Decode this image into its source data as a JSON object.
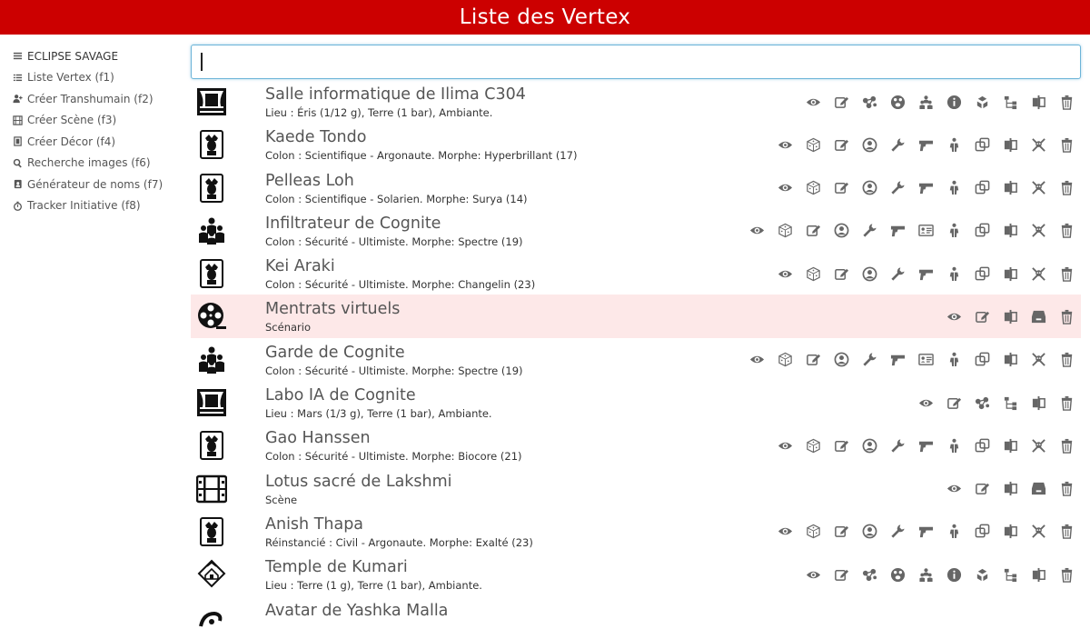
{
  "header": {
    "title": "Liste des Vertex"
  },
  "sidebar": {
    "items": [
      {
        "label": "ECLIPSE SAVAGE",
        "icon": "bars-icon"
      },
      {
        "label": "Liste Vertex (f1)",
        "icon": "list-icon"
      },
      {
        "label": "Créer Transhumain (f2)",
        "icon": "user-plus-icon"
      },
      {
        "label": "Créer Scène (f3)",
        "icon": "film-icon"
      },
      {
        "label": "Créer Décor (f4)",
        "icon": "door-icon"
      },
      {
        "label": "Recherche images (f6)",
        "icon": "search-icon"
      },
      {
        "label": "Générateur de noms (f7)",
        "icon": "address-book-icon"
      },
      {
        "label": "Tracker Initiative (f8)",
        "icon": "stopwatch-icon"
      }
    ]
  },
  "search": {
    "value": "",
    "placeholder": ""
  },
  "colors": {
    "header_bg": "#cc0000",
    "highlight_row": "#fde8e8",
    "icon_gray": "#666666",
    "search_border": "#6cb4d8"
  },
  "rows": [
    {
      "icon": "stage-icon",
      "title": "Salle informatique de Ilima C304",
      "subtitle": "Lieu : Éris (1/12 g), Terre (1 bar), Ambiante.",
      "actions": [
        "eye",
        "edit",
        "network",
        "paw",
        "group",
        "info",
        "cubes",
        "tree",
        "columns",
        "trash"
      ],
      "highlight": false
    },
    {
      "icon": "jester-icon",
      "title": "Kaede Tondo",
      "subtitle": "Colon : Scientifique - Argonaute. Morphe: Hyperbrillant (17)",
      "actions": [
        "eye",
        "dice",
        "edit",
        "user-circle",
        "wrench",
        "gun",
        "body",
        "clone",
        "columns",
        "crossbones",
        "trash"
      ],
      "highlight": false
    },
    {
      "icon": "jester-icon",
      "title": "Pelleas Loh",
      "subtitle": "Colon : Scientifique - Solarien. Morphe: Surya (14)",
      "actions": [
        "eye",
        "dice",
        "edit",
        "user-circle",
        "wrench",
        "gun",
        "body",
        "clone",
        "columns",
        "crossbones",
        "trash"
      ],
      "highlight": false
    },
    {
      "icon": "crowd-icon",
      "title": "Infiltrateur de Cognite",
      "subtitle": "Colon : Sécurité - Ultimiste. Morphe: Spectre (19)",
      "actions": [
        "eye",
        "dice",
        "edit",
        "user-circle",
        "wrench",
        "gun",
        "id-card",
        "body",
        "clone",
        "columns",
        "crossbones",
        "trash"
      ],
      "highlight": false
    },
    {
      "icon": "jester-icon",
      "title": "Kei Araki",
      "subtitle": "Colon : Sécurité - Ultimiste. Morphe: Changelin (23)",
      "actions": [
        "eye",
        "dice",
        "edit",
        "user-circle",
        "wrench",
        "gun",
        "body",
        "clone",
        "columns",
        "crossbones",
        "trash"
      ],
      "highlight": false
    },
    {
      "icon": "film-reel-icon",
      "title": "Mentrats virtuels",
      "subtitle": "Scénario",
      "actions": [
        "eye",
        "edit",
        "columns",
        "archive",
        "trash"
      ],
      "highlight": true
    },
    {
      "icon": "crowd-icon",
      "title": "Garde de Cognite",
      "subtitle": "Colon : Sécurité - Ultimiste. Morphe: Spectre (19)",
      "actions": [
        "eye",
        "dice",
        "edit",
        "user-circle",
        "wrench",
        "gun",
        "id-card",
        "body",
        "clone",
        "columns",
        "crossbones",
        "trash"
      ],
      "highlight": false
    },
    {
      "icon": "stage-icon",
      "title": "Labo IA de Cognite",
      "subtitle": "Lieu : Mars (1/3 g), Terre (1 bar), Ambiante.",
      "actions": [
        "eye",
        "edit",
        "network",
        "tree",
        "columns",
        "trash"
      ],
      "highlight": false
    },
    {
      "icon": "jester-icon",
      "title": "Gao Hanssen",
      "subtitle": "Colon : Sécurité - Ultimiste. Morphe: Biocore (21)",
      "actions": [
        "eye",
        "dice",
        "edit",
        "user-circle",
        "wrench",
        "gun",
        "body",
        "clone",
        "columns",
        "crossbones",
        "trash"
      ],
      "highlight": false
    },
    {
      "icon": "film-strip-icon",
      "title": "Lotus sacré de Lakshmi",
      "subtitle": "Scène",
      "actions": [
        "eye",
        "edit",
        "columns",
        "archive",
        "trash"
      ],
      "highlight": false
    },
    {
      "icon": "jester-icon",
      "title": "Anish Thapa",
      "subtitle": "Réinstancié : Civil - Argonaute. Morphe: Exalté (23)",
      "actions": [
        "eye",
        "dice",
        "edit",
        "user-circle",
        "wrench",
        "gun",
        "body",
        "clone",
        "columns",
        "crossbones",
        "trash"
      ],
      "highlight": false
    },
    {
      "icon": "temple-icon",
      "title": "Temple de Kumari",
      "subtitle": "Lieu : Terre (1 g), Terre (1 bar), Ambiante.",
      "actions": [
        "eye",
        "edit",
        "network",
        "paw",
        "group",
        "info",
        "cubes",
        "tree",
        "columns",
        "trash"
      ],
      "highlight": false
    },
    {
      "icon": "swirl-icon",
      "title": "Avatar de Yashka Malla",
      "subtitle": "",
      "actions": [],
      "highlight": false
    }
  ]
}
